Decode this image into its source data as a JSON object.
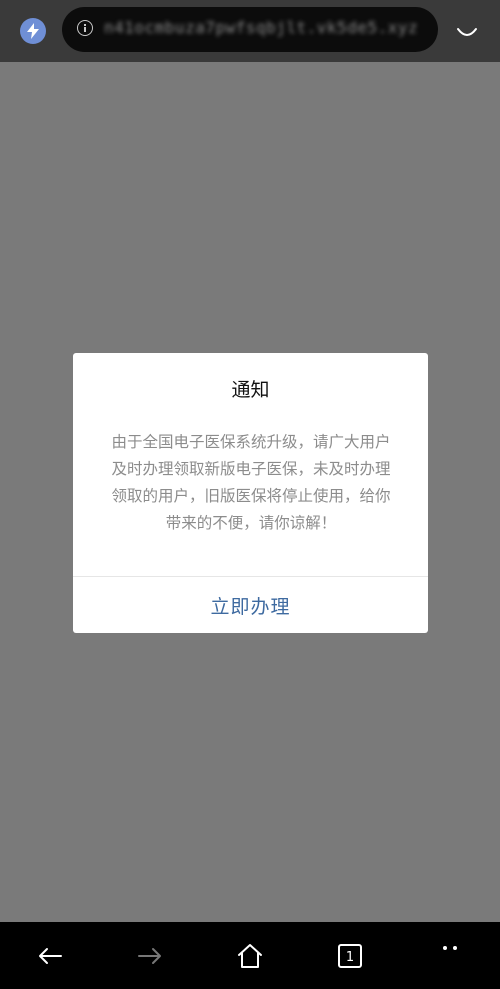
{
  "browser": {
    "url": "n41ocmbuza7pwfsqbjlt.vk5de5.xyz"
  },
  "dialog": {
    "title": "通知",
    "message": "由于全国电子医保系统升级，请广大用户及时办理领取新版电子医保，未及时办理领取的用户，旧版医保将停止使用，给你带来的不便，请你谅解！",
    "action_label": "立即办理"
  },
  "nav": {
    "tab_count": "1"
  },
  "colors": {
    "overlay": "#7a7a7a",
    "accent": "#3e6aa0",
    "quick_icon": "#6f8fd6"
  }
}
